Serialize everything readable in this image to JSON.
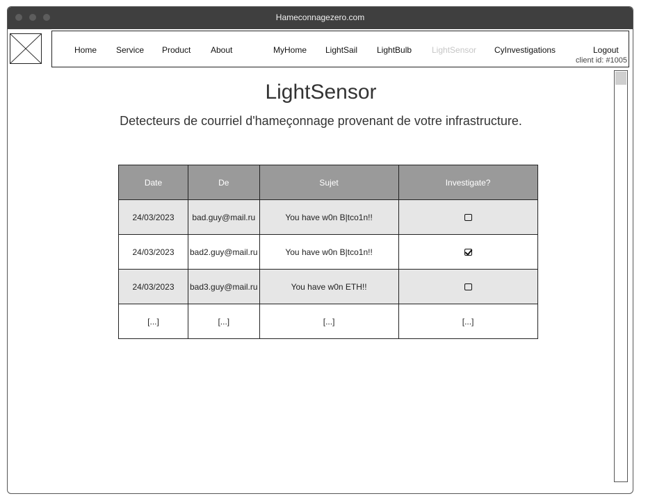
{
  "window": {
    "title": "Hameconnagezero.com"
  },
  "nav": {
    "items": [
      {
        "label": "Home",
        "disabled": false
      },
      {
        "label": "Service",
        "disabled": false
      },
      {
        "label": "Product",
        "disabled": false
      },
      {
        "label": "About",
        "disabled": false
      },
      {
        "label": "MyHome",
        "disabled": false
      },
      {
        "label": "LightSail",
        "disabled": false
      },
      {
        "label": "LightBulb",
        "disabled": false
      },
      {
        "label": "LightSensor",
        "disabled": true
      },
      {
        "label": "CyInvestigations",
        "disabled": false
      },
      {
        "label": "Logout",
        "disabled": false
      }
    ],
    "client_id": "client id: #1005"
  },
  "page": {
    "title": "LightSensor",
    "subtitle": "Detecteurs de courriel d'hameçonnage provenant de votre infrastructure."
  },
  "table": {
    "headers": [
      "Date",
      "De",
      "Sujet",
      "Investigate?"
    ],
    "rows": [
      {
        "date": "24/03/2023",
        "from": "bad.guy@mail.ru",
        "subject": "You have w0n B|tco1n!!",
        "investigate": false
      },
      {
        "date": "24/03/2023",
        "from": "bad2.guy@mail.ru",
        "subject": "You have w0n B|tco1n!!",
        "investigate": true
      },
      {
        "date": "24/03/2023",
        "from": "bad3.guy@mail.ru",
        "subject": "You have w0n ETH!!",
        "investigate": false
      },
      {
        "date": "[...]",
        "from": "[...]",
        "subject": "[...]",
        "investigate_text": "[...]"
      }
    ]
  },
  "icons": {
    "logo": "image-placeholder-icon",
    "checkbox": "checkbox-icon"
  },
  "colors": {
    "titlebar": "#3f3f3f",
    "table_header": "#9a9a9a",
    "row_alt": "#e6e6e6",
    "nav_disabled": "#c6c6c6"
  }
}
